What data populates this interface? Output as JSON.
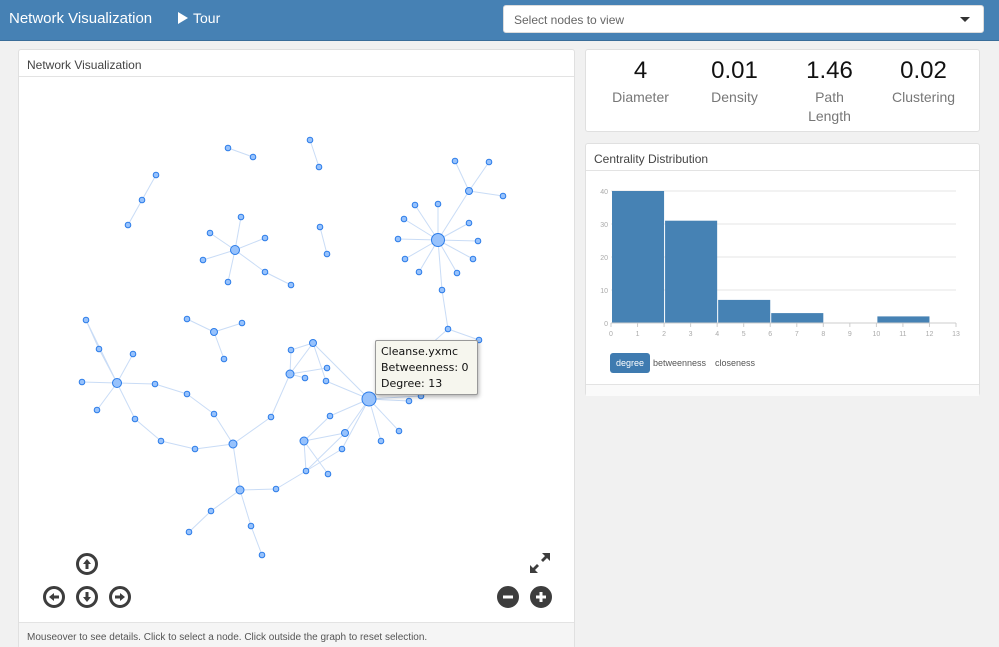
{
  "navbar": {
    "brand": "Network Visualization",
    "tour_label": "Tour",
    "select_placeholder": "Select nodes to view"
  },
  "network_panel": {
    "title": "Network Visualization",
    "footer": "Mouseover to see details. Click to select a node. Click outside the graph to reset selection.",
    "tooltip": {
      "name": "Cleanse.yxmc",
      "betweenness": "Betweenness: 0",
      "degree": "Degree: 13"
    },
    "controls": {
      "pan_up": "arrow-up-circle",
      "pan_left": "arrow-left-circle",
      "pan_down": "arrow-down-circle",
      "pan_right": "arrow-right-circle",
      "fit": "expand-arrows",
      "zoom_out": "minus-circle",
      "zoom_in": "plus-circle"
    },
    "colors": {
      "node_fill": "#97c2fc",
      "node_stroke": "#2b7ce9",
      "edge": "#c9dcf6"
    }
  },
  "stats": [
    {
      "value": "4",
      "label": "Diameter"
    },
    {
      "value": "0.01",
      "label": "Density"
    },
    {
      "value": "1.46",
      "label": "Path Length"
    },
    {
      "value": "0.02",
      "label": "Clustering"
    }
  ],
  "centrality_panel": {
    "title": "Centrality Distribution",
    "tabs": [
      {
        "label": "degree",
        "active": true
      },
      {
        "label": "betweenness",
        "active": false
      },
      {
        "label": "closeness",
        "active": false
      }
    ]
  },
  "chart_data": {
    "type": "bar",
    "title": "Centrality Distribution",
    "xlabel": "",
    "ylabel": "",
    "bins": [
      {
        "x0": 0,
        "x1": 2,
        "value": 40
      },
      {
        "x0": 2,
        "x1": 4,
        "value": 31
      },
      {
        "x0": 4,
        "x1": 6,
        "value": 7
      },
      {
        "x0": 6,
        "x1": 8,
        "value": 3
      },
      {
        "x0": 8,
        "x1": 10,
        "value": 0
      },
      {
        "x0": 10,
        "x1": 12,
        "value": 2
      }
    ],
    "xlim": [
      0,
      13
    ],
    "ylim": [
      0,
      40
    ],
    "xticks": [
      "0",
      "1",
      "2",
      "3",
      "4",
      "5",
      "6",
      "7",
      "8",
      "9",
      "10",
      "11",
      "12",
      "13"
    ],
    "yticks": [
      "0",
      "10",
      "20",
      "30",
      "40"
    ],
    "grid": true,
    "bar_color": "#4682b4"
  }
}
